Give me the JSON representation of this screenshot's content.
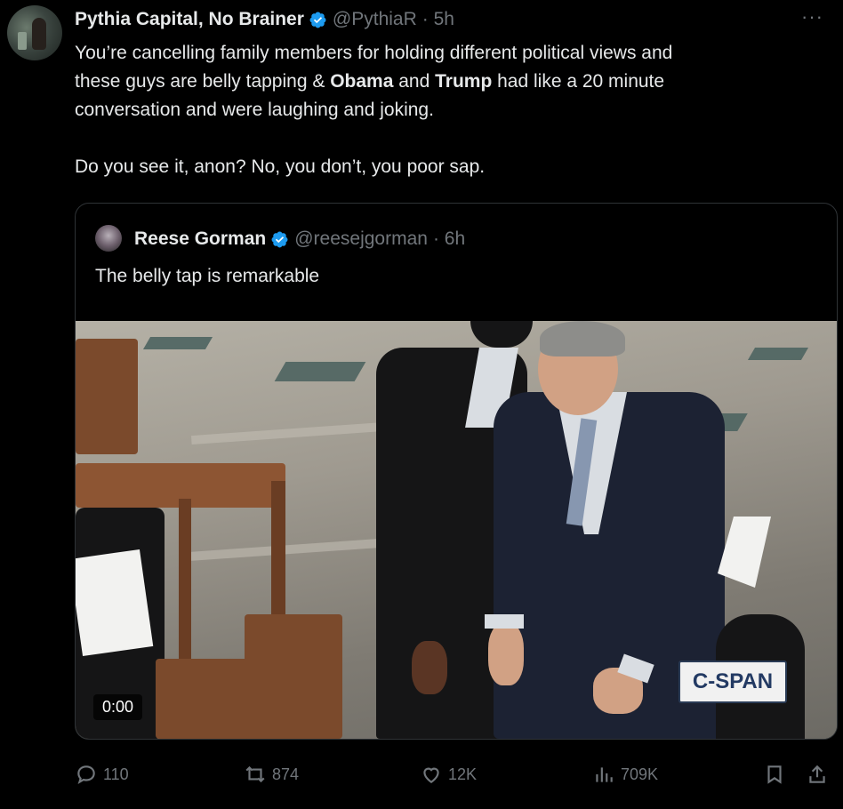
{
  "tweet": {
    "author_name": "Pythia Capital, No Brainer",
    "handle": "@PythiaR",
    "time": "· 5h",
    "more": "···",
    "text": {
      "line1": "You’re cancelling family members for holding different political views and",
      "line2_pre": "these guys are belly tapping & ",
      "line2_bold1": "Obama",
      "line2_mid": " and ",
      "line2_bold2": "Trump",
      "line2_post": " had like a 20 minute",
      "line3": "conversation and were laughing and joking.",
      "line4": "Do you see it, anon? No, you don’t, you poor sap."
    }
  },
  "quote": {
    "author_name": "Reese Gorman",
    "handle": "@reesejgorman",
    "time": "· 6h",
    "text": "The belly tap is remarkable",
    "video": {
      "timestamp": "0:00",
      "channel_logo": "C-SPAN"
    }
  },
  "actions": {
    "replies": "110",
    "reposts": "874",
    "likes": "12K",
    "views": "709K"
  },
  "colors": {
    "background": "#000000",
    "text": "#e7e9ea",
    "muted": "#71767b",
    "verified": "#1d9bf0",
    "border": "#2f3336"
  },
  "icons": [
    "reply-icon",
    "repost-icon",
    "like-icon",
    "views-icon",
    "bookmark-icon",
    "share-icon",
    "verified-badge-icon",
    "more-icon"
  ]
}
